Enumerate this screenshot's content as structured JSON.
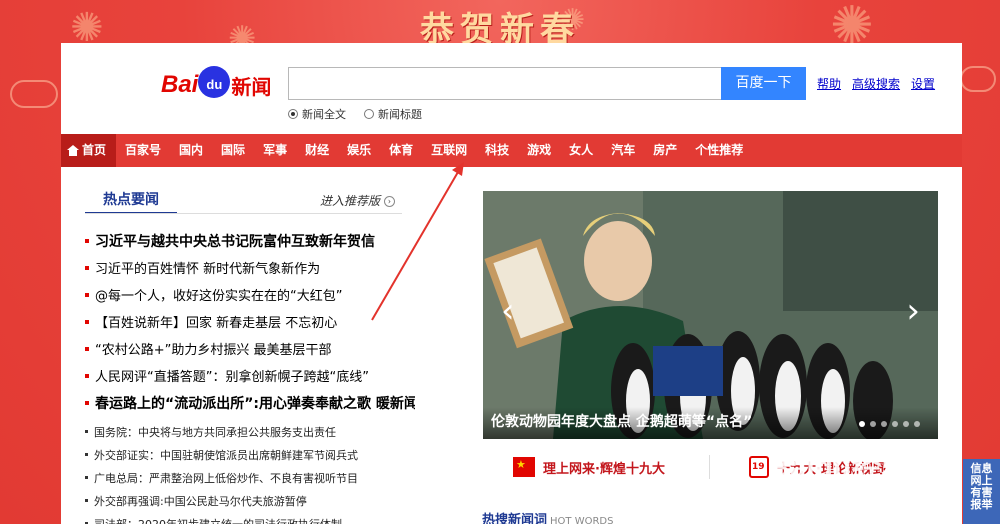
{
  "banner": {
    "title": "恭贺新春"
  },
  "logo": {
    "bai": "Bai",
    "du": "du",
    "news": "新闻"
  },
  "search": {
    "placeholder": "",
    "button_label": "百度一下"
  },
  "header_links": [
    "帮助",
    "高级搜索",
    "设置"
  ],
  "search_options": [
    {
      "label": "新闻全文",
      "selected": true
    },
    {
      "label": "新闻标题",
      "selected": false
    }
  ],
  "nav": {
    "items": [
      "首页",
      "百家号",
      "国内",
      "国际",
      "军事",
      "财经",
      "娱乐",
      "体育",
      "互联网",
      "科技",
      "游戏",
      "女人",
      "汽车",
      "房产",
      "个性推荐"
    ],
    "active": "首页"
  },
  "hot_news": {
    "tab_label": "热点要闻",
    "recommend_label": "进入推荐版",
    "items": [
      {
        "text": "习近平与越共中央总书记阮富仲互致新年贺信",
        "bold": true
      },
      {
        "text": "习近平的百姓情怀 新时代新气象新作为",
        "bold": false
      },
      {
        "text": "@每一个人，收好这份实实在在的“大红包”",
        "bold": false
      },
      {
        "text": "【百姓说新年】回家 新春走基层 不忘初心",
        "bold": false
      },
      {
        "text": "“农村公路+”助力乡村振兴 最美基层干部",
        "bold": false
      },
      {
        "text": "人民网评“直播答题”：别拿创新幌子跨越“底线”",
        "bold": false
      },
      {
        "text": "春运路上的“流动派出所”:用心弹奏奉献之歌 暖新闻",
        "bold": true
      }
    ],
    "small_items": [
      "国务院：中央将与地方共同承担公共服务支出责任",
      "外交部证实：中国驻朝使馆派员出席朝鲜建军节阅兵式",
      "广电总局：严肃整治网上低俗炒作、不良有害视听节目",
      "外交部再强调:中国公民赴马尔代夫旅游暂停",
      "司法部：2020年初步建立统一的司法行政执行体制"
    ]
  },
  "slider": {
    "caption": "伦敦动物园年度大盘点 企鹅超萌等“点名”",
    "prev_arrow": "‹",
    "next_arrow": "›",
    "dot_count": 6,
    "active_dot": 0
  },
  "promos": [
    {
      "text": "理上网来·辉煌十九大",
      "icon": "flag-icon"
    },
    {
      "text": "十九大·理论新视野",
      "icon": "calendar-icon"
    }
  ],
  "hot_search": {
    "label": "热搜新闻词",
    "en_label": "HOT WORDS"
  },
  "watermark": {
    "text": "Baidu经验",
    "url": "jingyan.baidu.com"
  },
  "side_panel": {
    "label": "信息网上有害报举"
  },
  "colors": {
    "nav_red": "#e23a34",
    "brand_blue": "#3385ff",
    "link_blue": "#0000cc",
    "headline_blue": "#1f3a93"
  }
}
